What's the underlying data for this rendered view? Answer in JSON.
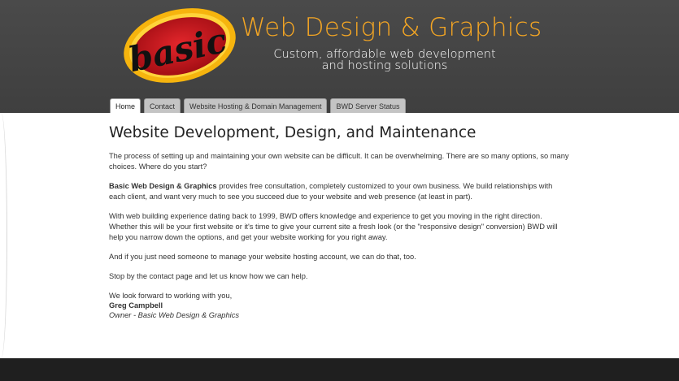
{
  "header": {
    "logo_text": "basic",
    "site_title": "Web Design & Graphics",
    "tagline_line1": "Custom, affordable web development",
    "tagline_line2": "and hosting solutions"
  },
  "nav": {
    "tabs": [
      {
        "label": "Home",
        "active": true
      },
      {
        "label": "Contact",
        "active": false
      },
      {
        "label": "Website Hosting & Domain Management",
        "active": false
      },
      {
        "label": "BWD Server Status",
        "active": false
      }
    ]
  },
  "main": {
    "heading": "Website Development, Design, and Maintenance",
    "p1": "The process of setting up and maintaining your own website can be difficult. It can be overwhelming. There are so many options, so many choices. Where do you start?",
    "p2_strong": "Basic Web Design & Graphics",
    "p2_rest": " provides free consultation, completely customized to your own business. We build relationships with each client, and want very much to see you succeed due to your website and web presence (at least in part).",
    "p3": "With web building experience dating back to 1999, BWD offers knowledge and experience to get you moving in the right direction. Whether this will be your first website or it's time to give your current site a fresh look (or the \"responsive design\" conversion) BWD will help you narrow down the options, and get your website working for you right away.",
    "p4": "And if you just need someone to manage your website hosting account, we can do that, too.",
    "p5": "Stop by the contact page and let us know how we can help.",
    "closing": "We look forward to working with you,",
    "signature_name": "Greg Campbell",
    "signature_role": "Owner - Basic Web Design & Graphics"
  },
  "colors": {
    "header_bg": "#444444",
    "title_orange": "#f5a623",
    "logo_red": "#c0121a",
    "logo_yellow": "#f7c21b",
    "footer_bg": "#1f1f1f"
  }
}
